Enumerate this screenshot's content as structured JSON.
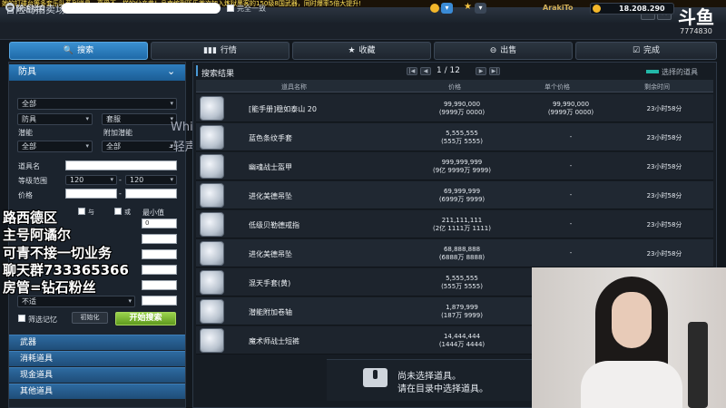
{
  "marquee": "她的打碟台等多套乐队系列道具，享受不一样的父亲节！品克缤副砾乐首次加入炼狱黑客的150级8国武器，同时爆率5倍大提升!",
  "window": {
    "title": "冒险岛拍卖场",
    "min": "—",
    "close": "✕",
    "extra": "退出"
  },
  "search": {
    "label": "快速搜索",
    "placeholder": "",
    "exact_label": "完全一致"
  },
  "account": {
    "name": "ArakiTo",
    "meso": "18.208.290"
  },
  "logo": {
    "mark": "斗鱼",
    "room_id": "7774830"
  },
  "tabs": [
    {
      "icon": "🔍",
      "label": "搜索"
    },
    {
      "icon": "▮▮▮",
      "label": "行情"
    },
    {
      "icon": "★",
      "label": "收藏"
    },
    {
      "icon": "⊖",
      "label": "出售"
    },
    {
      "icon": "☑",
      "label": "完成"
    }
  ],
  "filters": {
    "category": "防具",
    "sub_all": "全部",
    "type": "防具",
    "set": "套服",
    "potential_label": "潜能",
    "extra_potential_label": "附加潜能",
    "potential_value": "全部",
    "extra_potential_value": "全部",
    "item_name_label": "道具名",
    "level_label": "等级范围",
    "level_min": "120",
    "level_max": "120",
    "price_label": "价格",
    "and_label": "与",
    "or_label": "或",
    "min_label": "最小值",
    "min_value": "0",
    "not_apply": "不适",
    "memory_label": "筛选记忆",
    "reset_label": "初始化",
    "search_button": "开始搜索"
  },
  "categories": [
    "武器",
    "消耗道具",
    "现金道具",
    "其他道具"
  ],
  "overlay_lines": [
    "路西德区",
    "主号阿谲尔",
    "可青不接一切业务",
    "聊天群733365366",
    "房管=钻石粉丝"
  ],
  "watermark": {
    "line1": "Whispers",
    "line2": "-轻声问你"
  },
  "results": {
    "title": "搜索结果",
    "page": "1 / 12",
    "selected_label": "选择的道具",
    "columns": [
      "道具名称",
      "价格",
      "单个价格",
      "剩余时间"
    ],
    "rows": [
      {
        "name": "[能手册]稳如泰山 20",
        "price1": "99,990,000",
        "price2": "(9999万 0000)",
        "unit1": "99,990,000",
        "unit2": "(9999万 0000)",
        "time": "23小时58分"
      },
      {
        "name": "蓝色条纹手套",
        "price1": "5,555,555",
        "price2": "(555万 5555)",
        "unit1": "-",
        "unit2": "",
        "time": "23小时58分"
      },
      {
        "name": "幽魂战士盔甲",
        "price1": "999,999,999",
        "price2": "(9亿 9999万 9999)",
        "unit1": "-",
        "unit2": "",
        "time": "23小时58分"
      },
      {
        "name": "进化美德吊坠",
        "price1": "69,999,999",
        "price2": "(6999万 9999)",
        "unit1": "-",
        "unit2": "",
        "time": "23小时58分"
      },
      {
        "name": "低级贝勒德戒指",
        "price1": "211,111,111",
        "price2": "(2亿 1111万 1111)",
        "unit1": "-",
        "unit2": "",
        "time": "23小时58分"
      },
      {
        "name": "进化美德吊坠",
        "price1": "68,888,888",
        "price2": "(6888万 8888)",
        "unit1": "-",
        "unit2": "",
        "time": "23小时58分"
      },
      {
        "name": "混天手套(黄)",
        "price1": "5,555,555",
        "price2": "(555万 5555)",
        "unit1": "-",
        "unit2": "",
        "time": ""
      },
      {
        "name": "潜能附加卷轴",
        "price1": "1,879,999",
        "price2": "(187万 9999)",
        "unit1": "-",
        "unit2": "",
        "time": ""
      },
      {
        "name": "魔术师战士短裤",
        "price1": "14,444,444",
        "price2": "(1444万 4444)",
        "unit1": "-",
        "unit2": "",
        "time": ""
      }
    ]
  },
  "info": {
    "line1": "尚未选择道具。",
    "line2": "请在目录中选择道具。"
  }
}
